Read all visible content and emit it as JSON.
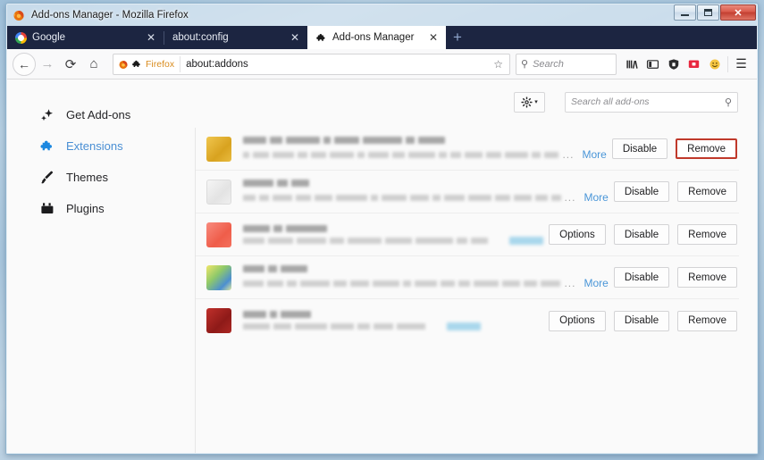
{
  "window": {
    "title": "Add-ons Manager - Mozilla Firefox",
    "controls": {
      "minimize": "minimize-button",
      "maximize": "maximize-button",
      "close": "✕"
    }
  },
  "tabs": [
    {
      "label": "Google",
      "favicon": "google-favicon",
      "close": "✕",
      "active": false
    },
    {
      "label": "about:config",
      "favicon": "none",
      "close": "✕",
      "active": false
    },
    {
      "label": "Add-ons Manager",
      "favicon": "puzzle-icon",
      "close": "✕",
      "active": true
    }
  ],
  "newtab_label": "+",
  "navbar": {
    "back_icon": "←",
    "forward_icon": "→",
    "reload_icon": "⟳",
    "home_icon": "⌂",
    "identity_label": "Firefox",
    "url": "about:addons",
    "star_icon": "☆",
    "search_icon": "⚲",
    "search_placeholder": "Search",
    "icons": [
      "library-icon",
      "sidebar-icon",
      "shield-icon",
      "screenshot-icon",
      "smiley-icon",
      "hamburger-menu-icon"
    ],
    "hamburger_glyph": "☰"
  },
  "sidebar": {
    "items": [
      {
        "label": "Get Add-ons",
        "icon": "get-addons-icon",
        "selected": false
      },
      {
        "label": "Extensions",
        "icon": "extensions-puzzle-icon",
        "selected": true
      },
      {
        "label": "Themes",
        "icon": "themes-brush-icon",
        "selected": false
      },
      {
        "label": "Plugins",
        "icon": "plugins-icon",
        "selected": false
      }
    ]
  },
  "list_header": {
    "gear_icon": "gear-icon",
    "gear_caret": "▾",
    "search_placeholder": "Search all add-ons",
    "search_icon": "⚲"
  },
  "addons": [
    {
      "icon_class": "ic-gold",
      "name_redacted": true,
      "desc_redacted": true,
      "ellipsis": "...",
      "more_label": "More",
      "has_blue_chip": false,
      "buttons": [
        {
          "label": "Disable",
          "highlight": false
        },
        {
          "label": "Remove",
          "highlight": true
        }
      ]
    },
    {
      "icon_class": "ic-gray",
      "name_redacted": true,
      "desc_redacted": true,
      "ellipsis": "...",
      "more_label": "More",
      "has_blue_chip": false,
      "buttons": [
        {
          "label": "Disable",
          "highlight": false
        },
        {
          "label": "Remove",
          "highlight": false
        }
      ]
    },
    {
      "icon_class": "ic-red",
      "name_redacted": true,
      "desc_redacted": true,
      "ellipsis": "",
      "more_label": "",
      "has_blue_chip": true,
      "buttons": [
        {
          "label": "Options",
          "highlight": false
        },
        {
          "label": "Disable",
          "highlight": false
        },
        {
          "label": "Remove",
          "highlight": false
        }
      ]
    },
    {
      "icon_class": "ic-multi",
      "name_redacted": true,
      "desc_redacted": true,
      "ellipsis": "...",
      "more_label": "More",
      "has_blue_chip": false,
      "buttons": [
        {
          "label": "Disable",
          "highlight": false
        },
        {
          "label": "Remove",
          "highlight": false
        }
      ]
    },
    {
      "icon_class": "ic-darkred",
      "name_redacted": true,
      "desc_redacted": true,
      "ellipsis": "",
      "more_label": "",
      "has_blue_chip": true,
      "buttons": [
        {
          "label": "Options",
          "highlight": false
        },
        {
          "label": "Disable",
          "highlight": false
        },
        {
          "label": "Remove",
          "highlight": false
        }
      ]
    }
  ],
  "colors": {
    "tabstrip_bg": "#1c2541",
    "accent_link": "#4a96d8",
    "highlight_border": "#c0392b",
    "selected_category": "#4a8fd4"
  }
}
